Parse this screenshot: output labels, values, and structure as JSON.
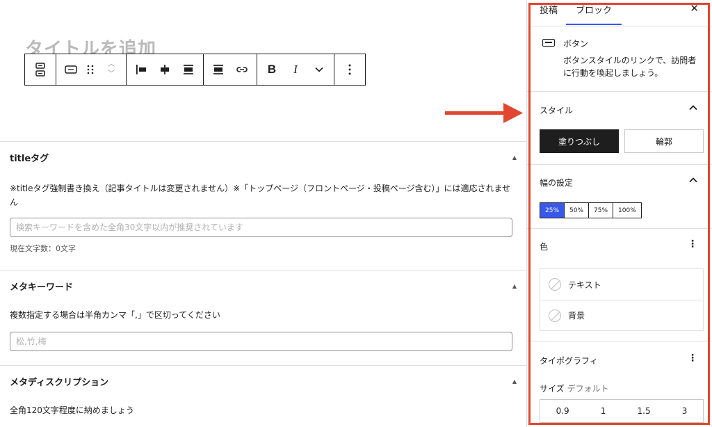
{
  "editor": {
    "post_title_placeholder": "タイトルを追加",
    "toolbar": {
      "format_b": "B",
      "format_i": "I"
    }
  },
  "metaboxes": [
    {
      "title": "titleタグ",
      "desc": "※titleタグ強制書き換え（記事タイトルは変更されません）※「トップページ（フロントページ・投稿ページ含む）」には適応されません",
      "placeholder": "検索キーワードを含めた全角30文字以内が推奨されています",
      "count": "現在文字数：0文字"
    },
    {
      "title": "メタキーワード",
      "desc": "複数指定する場合は半角カンマ「,」で区切ってください",
      "placeholder": "松,竹,梅"
    },
    {
      "title": "メタディスクリプション",
      "desc": "全角120文字程度に納めましょう"
    }
  ],
  "sidebar": {
    "tabs": [
      "投稿",
      "ブロック"
    ],
    "active_tab": "ブロック",
    "close_label": "✕",
    "block": {
      "name": "ボタン",
      "description": "ボタンスタイルのリンクで、訪問者に行動を喚起しましょう。"
    },
    "style_panel": {
      "title": "スタイル",
      "options": [
        "塗りつぶし",
        "輪郭"
      ],
      "selected": "塗りつぶし"
    },
    "width_panel": {
      "title": "幅の設定",
      "options": [
        "25%",
        "50%",
        "75%",
        "100%"
      ],
      "selected": "25%"
    },
    "color_panel": {
      "title": "色",
      "items": [
        "テキスト",
        "背景"
      ]
    },
    "typography_panel": {
      "title": "タイポグラフィ",
      "size_label": "サイズ",
      "size_value": "デフォルト",
      "size_options": [
        "0.9",
        "1",
        "1.5",
        "3"
      ]
    }
  },
  "colors": {
    "highlight_frame": "#e1462e",
    "accent": "#3858e9",
    "text": "#1e1e1e"
  }
}
